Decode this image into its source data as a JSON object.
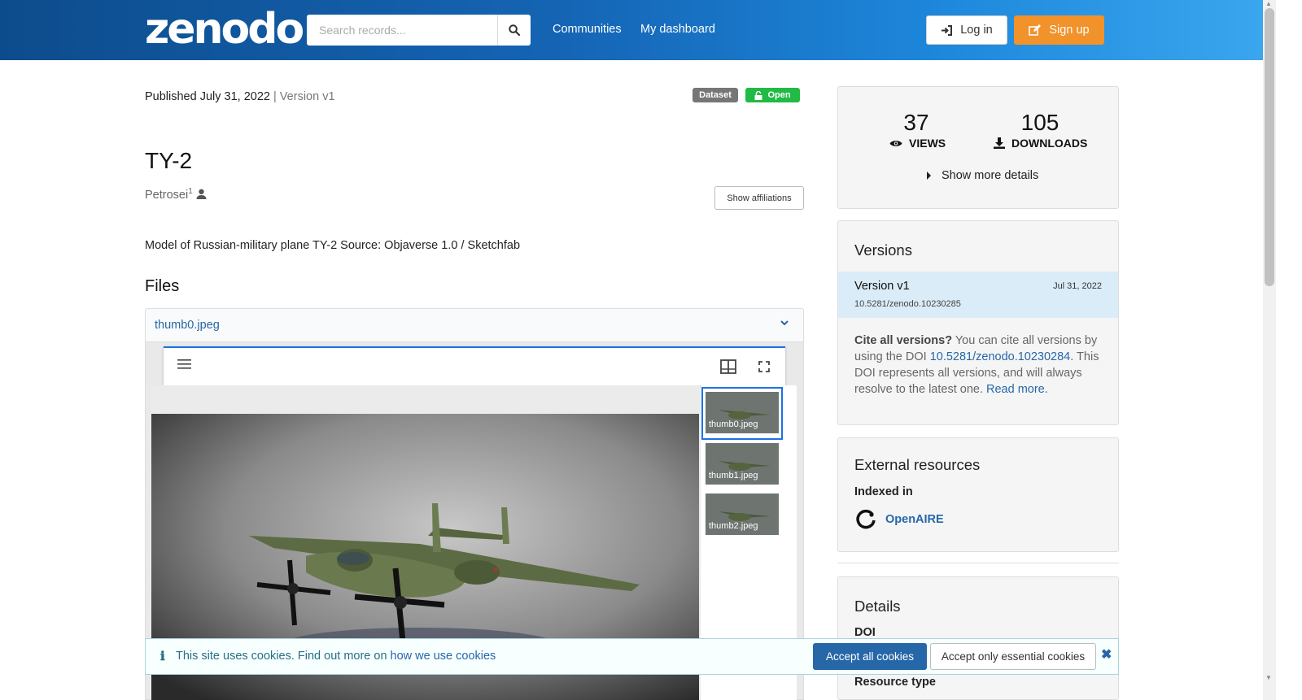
{
  "header": {
    "logo": "zenodo",
    "search_placeholder": "Search records...",
    "nav": [
      "Communities",
      "My dashboard"
    ],
    "login_label": "Log in",
    "signup_label": "Sign up"
  },
  "record": {
    "published": "Published July 31, 2022",
    "version": "| Version v1",
    "badge_type": "Dataset",
    "badge_access": "Open",
    "title": "TY-2",
    "author": "Petrosei",
    "author_sup": "1",
    "show_affiliations": "Show affiliations",
    "description": "Model of Russian-military plane TY-2 Source: Objaverse 1.0 / Sketchfab",
    "files_heading": "Files",
    "file_name": "thumb0.jpeg",
    "thumbnails": [
      "thumb0.jpeg",
      "thumb1.jpeg",
      "thumb2.jpeg"
    ]
  },
  "stats": {
    "views": "37",
    "views_label": "VIEWS",
    "downloads": "105",
    "downloads_label": "DOWNLOADS",
    "more": "Show more details"
  },
  "versions": {
    "heading": "Versions",
    "item_label": "Version v1",
    "item_date": "Jul 31, 2022",
    "item_doi": "10.5281/zenodo.10230285",
    "cite_bold": "Cite all versions?",
    "cite_text1": " You can cite all versions by using the DOI ",
    "cite_doi": "10.5281/zenodo.10230284",
    "cite_text2": ". This DOI represents all versions, and will always resolve to the latest one. ",
    "read_more": "Read more."
  },
  "external": {
    "heading": "External resources",
    "indexed_in": "Indexed in",
    "openaire": "OpenAIRE"
  },
  "details": {
    "heading": "Details",
    "doi_label": "DOI",
    "resource_type_label": "Resource type"
  },
  "cookie": {
    "text": "This site uses cookies. Find out more on ",
    "link": "how we use cookies",
    "accept_all": "Accept all cookies",
    "accept_essential": "Accept only essential cookies"
  },
  "colors": {
    "brand_blue": "#2667a8",
    "signup_orange": "#f1922b",
    "open_green": "#21ba45",
    "dataset_gray": "#767676"
  }
}
